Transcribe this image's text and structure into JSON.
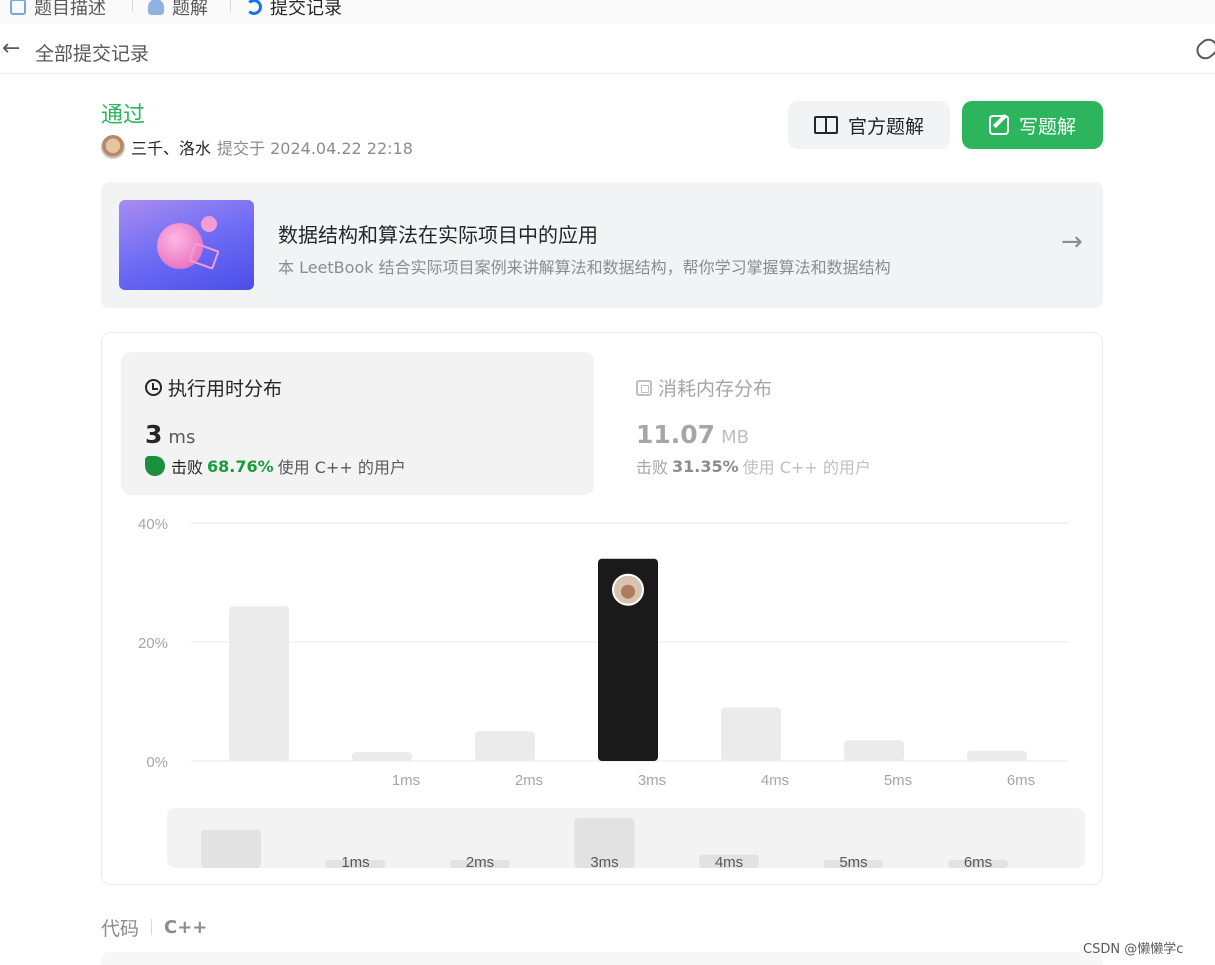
{
  "tabs": [
    {
      "label": "题目描述"
    },
    {
      "label": "题解"
    },
    {
      "label": "提交记录"
    }
  ],
  "back": {
    "label": "全部提交记录"
  },
  "header": {
    "status": "通过",
    "user": "三千、洛水",
    "submitted": "提交于 2024.04.22 22:18",
    "official_solution_label": "官方题解",
    "write_solution_label": "写题解"
  },
  "promo": {
    "title": "数据结构和算法在实际项目中的应用",
    "desc": "本 LeetBook 结合实际项目案例来讲解算法和数据结构，帮你学习掌握算法和数据结构"
  },
  "runtime": {
    "title": "执行用时分布",
    "value": "3",
    "unit": "ms",
    "beat_prefix": "击败",
    "beat_pct": "68.76%",
    "beat_suffix": "使用 C++ 的用户"
  },
  "memory": {
    "title": "消耗内存分布",
    "value": "11.07",
    "unit": "MB",
    "beat_prefix": "击败",
    "beat_pct": "31.35%",
    "beat_suffix": "使用 C++ 的用户"
  },
  "code": {
    "label": "代码",
    "lang": "C++"
  },
  "watermark": "CSDN @懒懒学c",
  "colors": {
    "accent": "#2db55d",
    "selected_bar": "#1a1a1a",
    "bar": "#ebebeb"
  },
  "chart_data": {
    "type": "bar",
    "categories": [
      "",
      "1ms",
      "2ms",
      "3ms",
      "4ms",
      "5ms",
      "6ms"
    ],
    "values": [
      26,
      1.5,
      5,
      34,
      9,
      3.5,
      1.7
    ],
    "y_ticks": [
      "0%",
      "20%",
      "40%"
    ],
    "ylim": [
      0,
      40
    ],
    "selected_category": "3ms",
    "grid": true
  }
}
